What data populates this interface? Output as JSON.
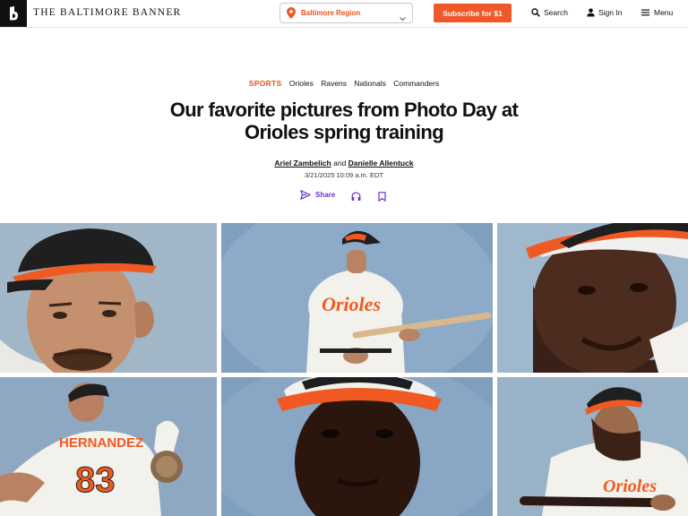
{
  "header": {
    "brand": "THE BALTIMORE BANNER",
    "logo_letter": "B",
    "region": "Baltimore Region",
    "subscribe": "Subscribe for $1",
    "search": "Search",
    "sign_in": "Sign In",
    "menu": "Menu",
    "accent_color": "#f0582a"
  },
  "article": {
    "section": "SPORTS",
    "tags": [
      "Orioles",
      "Ravens",
      "Nationals",
      "Commanders"
    ],
    "title_line1": "Our favorite pictures from Photo Day at",
    "title_line2": "Orioles spring training",
    "author1": "Ariel Zambelich",
    "and": "and",
    "author2": "Danielle Allentuck",
    "date": "3/21/2025 10:09 a.m. EDT",
    "share": "Share",
    "action_color": "#6a2fd4"
  },
  "photos": {
    "p2_jersey": "Orioles",
    "p4_name": "HERNANDEZ",
    "p4_number": "83",
    "p6_jersey": "Orioles"
  }
}
